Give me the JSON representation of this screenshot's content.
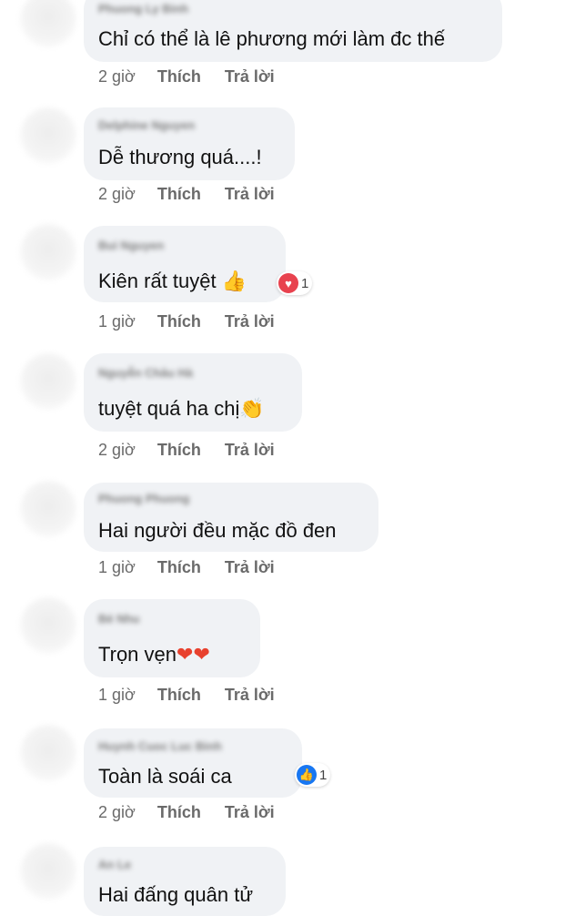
{
  "comments": [
    {
      "name": "Phuong Ly Binh",
      "text": "Chỉ có thể là lê phương mới làm đc thế",
      "time": "2 giờ",
      "like": "Thích",
      "reply": "Trả lời"
    },
    {
      "name": "Delphine Nguyen",
      "text": "Dễ thương quá....!",
      "time": "2 giờ",
      "like": "Thích",
      "reply": "Trả lời"
    },
    {
      "name": "Bui Nguyen",
      "text": "Kiên rất tuyệt ",
      "emoji": "👍",
      "reaction": {
        "icon": "heart",
        "count": "1"
      },
      "time": "1 giờ",
      "like": "Thích",
      "reply": "Trả lời"
    },
    {
      "name": "Nguyễn Châu Hà",
      "text": "tuyệt quá ha chị",
      "emoji": "👏",
      "time": "2 giờ",
      "like": "Thích",
      "reply": "Trả lời"
    },
    {
      "name": "Phuong Phuong",
      "text": "Hai người đều mặc đồ đen",
      "time": "1 giờ",
      "like": "Thích",
      "reply": "Trả lời"
    },
    {
      "name": "Bé Nhu",
      "text": "Trọn vẹn",
      "emoji": "❤❤",
      "time": "1 giờ",
      "like": "Thích",
      "reply": "Trả lời"
    },
    {
      "name": "Huynh Cuoc Luc Binh",
      "text": "Toàn là soái ca",
      "reaction": {
        "icon": "like",
        "count": "1"
      },
      "time": "2 giờ",
      "like": "Thích",
      "reply": "Trả lời"
    },
    {
      "name": "An Le",
      "text": "Hai đấng quân tử"
    }
  ],
  "colors": {
    "bubble": "#f0f2f5",
    "heart": "#e8424e",
    "like": "#1877f2"
  }
}
